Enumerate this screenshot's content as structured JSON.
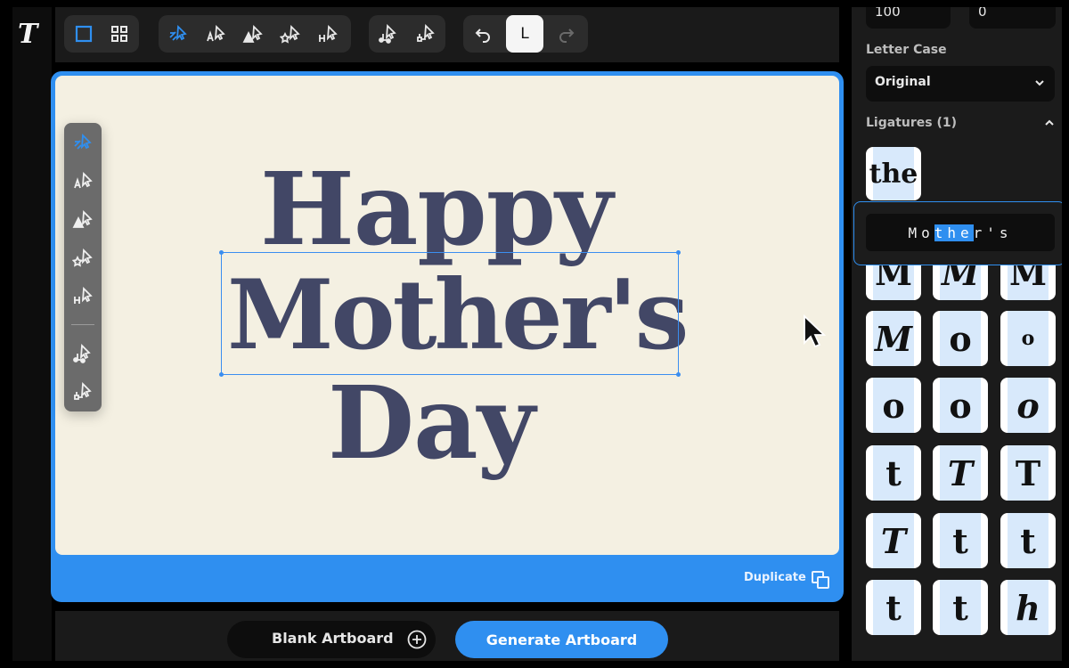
{
  "app": {
    "logo_text": "T"
  },
  "toolbar": {
    "groups": [
      {
        "name": "view",
        "items": [
          "single-view-icon",
          "grid-view-icon"
        ]
      },
      {
        "name": "type-tools",
        "items": [
          "random-style-icon",
          "letter-style-icon",
          "weight-style-icon",
          "decorative-style-icon",
          "spacing-style-icon"
        ]
      },
      {
        "name": "connect-tools",
        "items": [
          "node-connect-icon",
          "node-alt-icon"
        ]
      },
      {
        "name": "history",
        "items": [
          "undo-icon",
          "layout-toggle-icon",
          "redo-icon"
        ]
      }
    ],
    "layout_toggle_label": "L"
  },
  "inputs": {
    "top_left_value": "100",
    "top_right_value": "0"
  },
  "artboard": {
    "background": "#f4f0e2",
    "text_color": "#424766",
    "line1": "Happy",
    "line2": "Mother's",
    "line3": "Day",
    "duplicate_label": "Duplicate"
  },
  "palette": {
    "items": [
      "random-style-icon",
      "letter-style-icon",
      "weight-style-icon",
      "decorative-style-icon",
      "spacing-style-icon",
      "node-connect-icon",
      "node-alt-icon"
    ]
  },
  "bottom": {
    "blank_label": "Blank Artboard",
    "generate_label": "Generate Artboard"
  },
  "panel": {
    "letter_case_label": "Letter Case",
    "letter_case_value": "Original",
    "ligatures_label": "Ligatures (1)",
    "ligature_sample": "the",
    "tooltip": {
      "before": "Mo",
      "highlight": "the",
      "after": "r's"
    },
    "glyph_rows": [
      [
        "M",
        "M",
        "M"
      ],
      [
        "M",
        "o",
        "o"
      ],
      [
        "o",
        "o",
        "o"
      ],
      [
        "t",
        "T",
        "T"
      ],
      [
        "T",
        "t",
        "t"
      ],
      [
        "t",
        "t",
        "h"
      ]
    ]
  },
  "colors": {
    "accent": "#2f8ff0",
    "panel_bg": "#1b1b1b",
    "dark": "#0e0e0e"
  }
}
